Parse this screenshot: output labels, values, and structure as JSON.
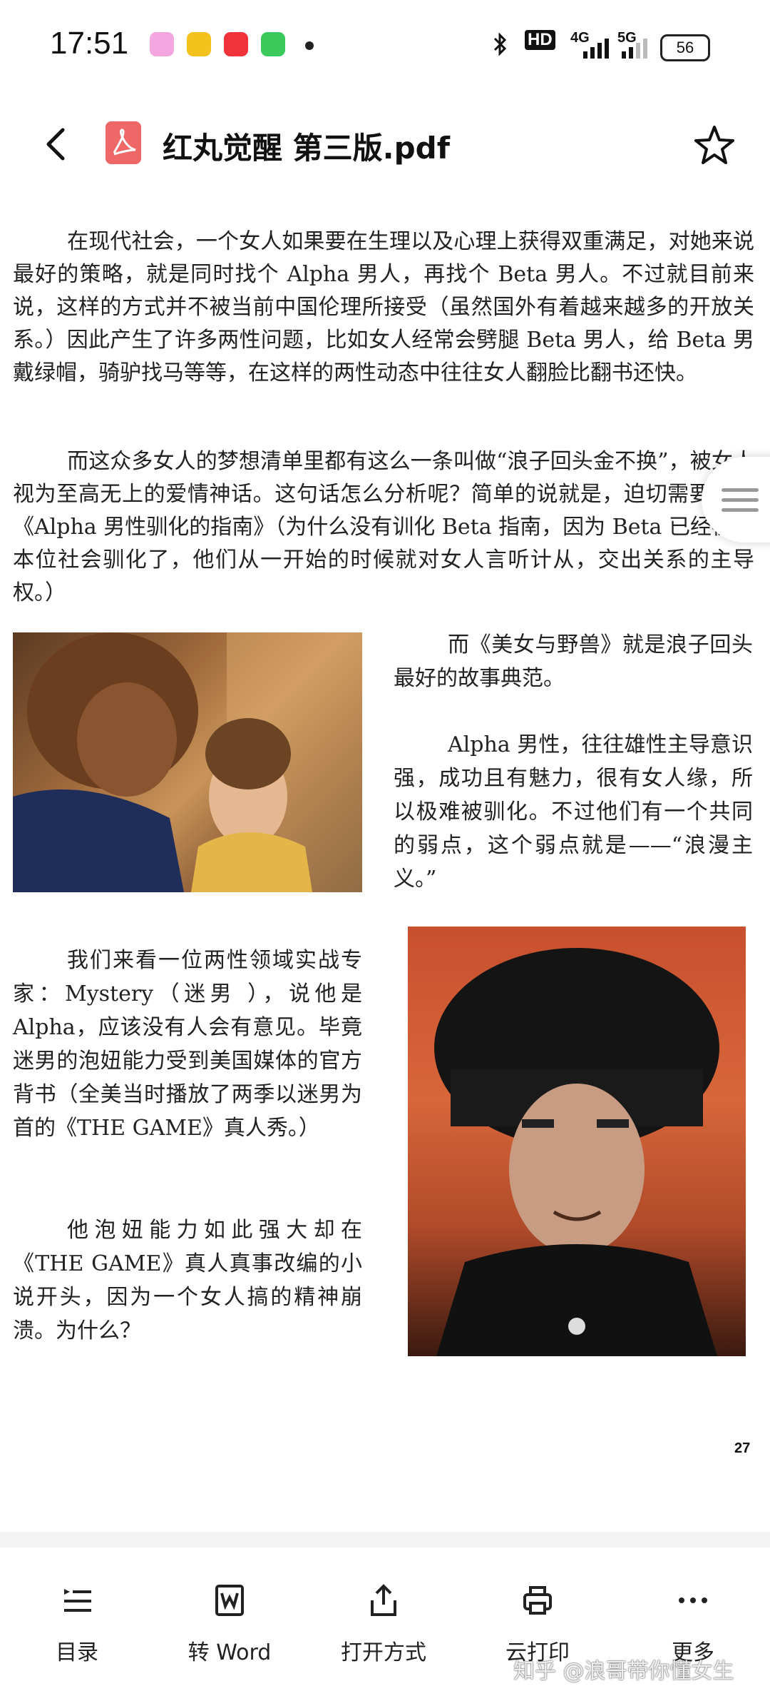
{
  "status_bar": {
    "time": "17:51",
    "hd_label": "HD",
    "net_label": "4G",
    "net2_label": "5G",
    "battery": "56"
  },
  "header": {
    "title": "红丸觉醒 第三版.pdf"
  },
  "document": {
    "para1": "在现代社会，一个女人如果要在生理以及心理上获得双重满足，对她来说最好的策略，就是同时找个 Alpha 男人，再找个 Beta 男人。不过就目前来说，这样的方式并不被当前中国伦理所接受（虽然国外有着越来越多的开放关系。）因此产生了许多两性问题，比如女人经常会劈腿 Beta 男人，给 Beta 男戴绿帽，骑驴找马等等，在这样的两性动态中往往女人翻脸比翻书还快。",
    "para2": "而这众多女人的梦想清单里都有这么一条叫做“浪子回头金不换”，被女人视为至高无上的爱情神话。这句话怎么分析呢？简单的说就是，迫切需要一本《Alpha 男性驯化的指南》（为什么没有训化 Beta 指南，因为 Beta 已经被女本位社会驯化了，他们从一开始的时候就对女人言听计从，交出关系的主导权。）",
    "right_col_p1": "而《美女与野兽》就是浪子回头最好的故事典范。",
    "right_col_p2": "Alpha 男性，往往雄性主导意识强，成功且有魅力，很有女人缘，所以极难被驯化。不过他们有一个共同的弱点，这个弱点就是——“浪漫主义。”",
    "left_col_p1": "我们来看一位两性领域实战专家：Mystery（迷男 ），说他是 Alpha，应该没有人会有意见。毕竟迷男的泡妞能力受到美国媒体的官方背书（全美当时播放了两季以迷男为首的《THE GAME》真人秀。）",
    "left_col_p2": "他泡妞能力如此强大却在《THE GAME》真人真事改编的小说开头，因为一个女人搞的精神崩溃。为什么？",
    "page_number": "27"
  },
  "toolbar": {
    "items": [
      {
        "label": "目录",
        "icon": "list-icon"
      },
      {
        "label": "转 Word",
        "icon": "word-icon"
      },
      {
        "label": "打开方式",
        "icon": "share-icon"
      },
      {
        "label": "云打印",
        "icon": "print-icon"
      },
      {
        "label": "更多",
        "icon": "more-icon"
      }
    ]
  },
  "watermark": "知乎 @浪哥带你懂女生",
  "colors": {
    "pdf_icon": "#f06767",
    "background": "#ffffff",
    "divider": "#f3f3f3"
  }
}
